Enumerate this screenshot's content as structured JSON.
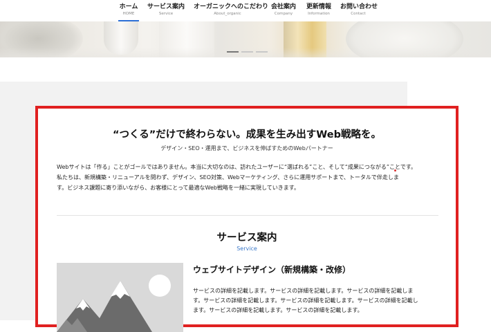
{
  "nav": {
    "items": [
      {
        "jp": "ホーム",
        "en": "HOME"
      },
      {
        "jp": "サービス案内",
        "en": "Service"
      },
      {
        "jp": "オーガニックへのこだわり",
        "en": "About_organic"
      },
      {
        "jp": "会社案内",
        "en": "Company"
      },
      {
        "jp": "更新情報",
        "en": "Information"
      },
      {
        "jp": "お問い合わせ",
        "en": "Contact"
      }
    ],
    "active_index": 0
  },
  "hero": {
    "slide_count": 3,
    "active_slide": 1
  },
  "lead": {
    "title": "“つくる”だけで終わらない。成果を生み出すWeb戦略を。",
    "subtitle": "デザイン・SEO・運用まで、ビジネスを伸ばすためのWebパートナー",
    "body": [
      "Webサイトは「作る」ことがゴールではありません。本当に大切なのは、訪れたユーザーに“選ばれる”こと、そして“成果につながる”ことです。",
      "私たちは、新規構築・リニューアルを問わず、デザイン、SEO対策、Webマーケティング、さらに運用サポートまで、トータルで伴走しま",
      "す。ビジネス課題に寄り添いながら、お客様にとって最適なWeb戦略を一緒に実現していきます。"
    ]
  },
  "services": {
    "title": "サービス案内",
    "subtitle": "Service",
    "items": [
      {
        "title": "ウェブサイトデザイン（新規構築・改修）",
        "text": [
          "サービスの詳細を記載します。サービスの詳細を記載します。サービスの詳細を記載しま",
          "す。サービスの詳細を記載します。サービスの詳細を記載します。サービスの詳細を記載し",
          "ます。サービスの詳細を記載します。サービスの詳細を記載します。"
        ],
        "image_icon": "image-placeholder-icon"
      }
    ]
  },
  "colors": {
    "accent_border": "#e02020",
    "link_blue": "#3a78c9",
    "nav_active": "#2c6fd6"
  }
}
